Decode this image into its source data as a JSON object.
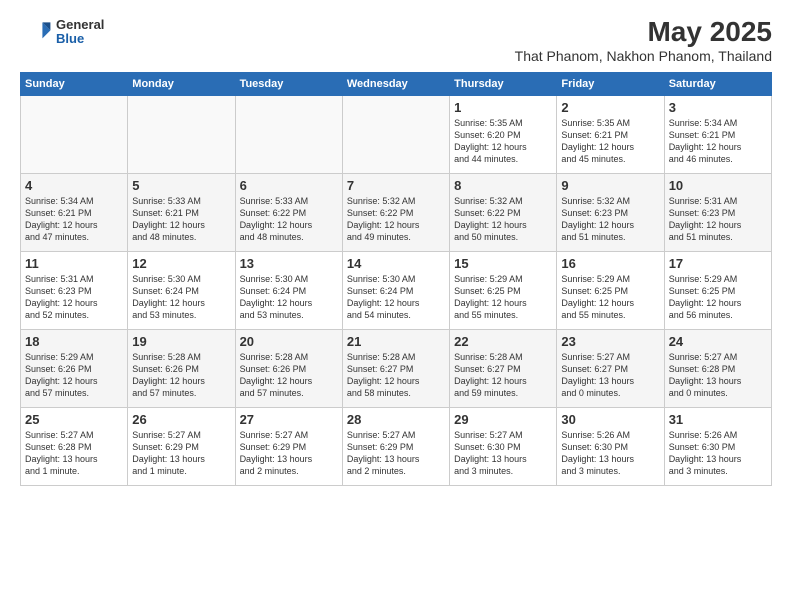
{
  "logo": {
    "general": "General",
    "blue": "Blue"
  },
  "title": "May 2025",
  "subtitle": "That Phanom, Nakhon Phanom, Thailand",
  "headers": [
    "Sunday",
    "Monday",
    "Tuesday",
    "Wednesday",
    "Thursday",
    "Friday",
    "Saturday"
  ],
  "weeks": [
    [
      {
        "day": "",
        "info": ""
      },
      {
        "day": "",
        "info": ""
      },
      {
        "day": "",
        "info": ""
      },
      {
        "day": "",
        "info": ""
      },
      {
        "day": "1",
        "info": "Sunrise: 5:35 AM\nSunset: 6:20 PM\nDaylight: 12 hours\nand 44 minutes."
      },
      {
        "day": "2",
        "info": "Sunrise: 5:35 AM\nSunset: 6:21 PM\nDaylight: 12 hours\nand 45 minutes."
      },
      {
        "day": "3",
        "info": "Sunrise: 5:34 AM\nSunset: 6:21 PM\nDaylight: 12 hours\nand 46 minutes."
      }
    ],
    [
      {
        "day": "4",
        "info": "Sunrise: 5:34 AM\nSunset: 6:21 PM\nDaylight: 12 hours\nand 47 minutes."
      },
      {
        "day": "5",
        "info": "Sunrise: 5:33 AM\nSunset: 6:21 PM\nDaylight: 12 hours\nand 48 minutes."
      },
      {
        "day": "6",
        "info": "Sunrise: 5:33 AM\nSunset: 6:22 PM\nDaylight: 12 hours\nand 48 minutes."
      },
      {
        "day": "7",
        "info": "Sunrise: 5:32 AM\nSunset: 6:22 PM\nDaylight: 12 hours\nand 49 minutes."
      },
      {
        "day": "8",
        "info": "Sunrise: 5:32 AM\nSunset: 6:22 PM\nDaylight: 12 hours\nand 50 minutes."
      },
      {
        "day": "9",
        "info": "Sunrise: 5:32 AM\nSunset: 6:23 PM\nDaylight: 12 hours\nand 51 minutes."
      },
      {
        "day": "10",
        "info": "Sunrise: 5:31 AM\nSunset: 6:23 PM\nDaylight: 12 hours\nand 51 minutes."
      }
    ],
    [
      {
        "day": "11",
        "info": "Sunrise: 5:31 AM\nSunset: 6:23 PM\nDaylight: 12 hours\nand 52 minutes."
      },
      {
        "day": "12",
        "info": "Sunrise: 5:30 AM\nSunset: 6:24 PM\nDaylight: 12 hours\nand 53 minutes."
      },
      {
        "day": "13",
        "info": "Sunrise: 5:30 AM\nSunset: 6:24 PM\nDaylight: 12 hours\nand 53 minutes."
      },
      {
        "day": "14",
        "info": "Sunrise: 5:30 AM\nSunset: 6:24 PM\nDaylight: 12 hours\nand 54 minutes."
      },
      {
        "day": "15",
        "info": "Sunrise: 5:29 AM\nSunset: 6:25 PM\nDaylight: 12 hours\nand 55 minutes."
      },
      {
        "day": "16",
        "info": "Sunrise: 5:29 AM\nSunset: 6:25 PM\nDaylight: 12 hours\nand 55 minutes."
      },
      {
        "day": "17",
        "info": "Sunrise: 5:29 AM\nSunset: 6:25 PM\nDaylight: 12 hours\nand 56 minutes."
      }
    ],
    [
      {
        "day": "18",
        "info": "Sunrise: 5:29 AM\nSunset: 6:26 PM\nDaylight: 12 hours\nand 57 minutes."
      },
      {
        "day": "19",
        "info": "Sunrise: 5:28 AM\nSunset: 6:26 PM\nDaylight: 12 hours\nand 57 minutes."
      },
      {
        "day": "20",
        "info": "Sunrise: 5:28 AM\nSunset: 6:26 PM\nDaylight: 12 hours\nand 57 minutes."
      },
      {
        "day": "21",
        "info": "Sunrise: 5:28 AM\nSunset: 6:27 PM\nDaylight: 12 hours\nand 58 minutes."
      },
      {
        "day": "22",
        "info": "Sunrise: 5:28 AM\nSunset: 6:27 PM\nDaylight: 12 hours\nand 59 minutes."
      },
      {
        "day": "23",
        "info": "Sunrise: 5:27 AM\nSunset: 6:27 PM\nDaylight: 13 hours\nand 0 minutes."
      },
      {
        "day": "24",
        "info": "Sunrise: 5:27 AM\nSunset: 6:28 PM\nDaylight: 13 hours\nand 0 minutes."
      }
    ],
    [
      {
        "day": "25",
        "info": "Sunrise: 5:27 AM\nSunset: 6:28 PM\nDaylight: 13 hours\nand 1 minute."
      },
      {
        "day": "26",
        "info": "Sunrise: 5:27 AM\nSunset: 6:29 PM\nDaylight: 13 hours\nand 1 minute."
      },
      {
        "day": "27",
        "info": "Sunrise: 5:27 AM\nSunset: 6:29 PM\nDaylight: 13 hours\nand 2 minutes."
      },
      {
        "day": "28",
        "info": "Sunrise: 5:27 AM\nSunset: 6:29 PM\nDaylight: 13 hours\nand 2 minutes."
      },
      {
        "day": "29",
        "info": "Sunrise: 5:27 AM\nSunset: 6:30 PM\nDaylight: 13 hours\nand 3 minutes."
      },
      {
        "day": "30",
        "info": "Sunrise: 5:26 AM\nSunset: 6:30 PM\nDaylight: 13 hours\nand 3 minutes."
      },
      {
        "day": "31",
        "info": "Sunrise: 5:26 AM\nSunset: 6:30 PM\nDaylight: 13 hours\nand 3 minutes."
      }
    ]
  ]
}
